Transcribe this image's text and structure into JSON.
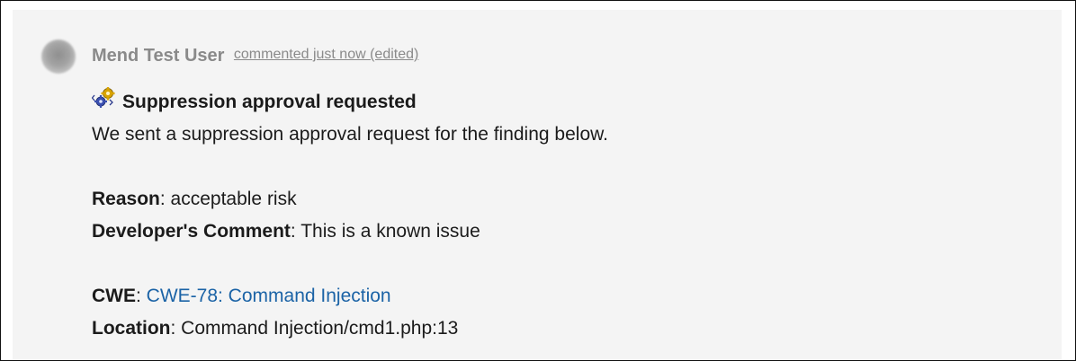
{
  "comment": {
    "author": "Mend Test User",
    "timestamp": "commented just now (edited)",
    "icon": "gears-icon",
    "title": "Suppression approval requested",
    "intro": "We sent a suppression approval request for the finding below.",
    "reason_label": "Reason",
    "reason_value": "acceptable risk",
    "dev_comment_label": "Developer's Comment",
    "dev_comment_value": "This is a known issue",
    "cwe_label": "CWE",
    "cwe_link": "CWE-78: Command Injection",
    "location_label": "Location",
    "location_value": "Command Injection/cmd1.php:13",
    "separator": ": "
  },
  "colors": {
    "background": "#f4f4f4",
    "author_text": "#8a8a8a",
    "body_text": "#1b1b1b",
    "link": "#1b63a6"
  }
}
